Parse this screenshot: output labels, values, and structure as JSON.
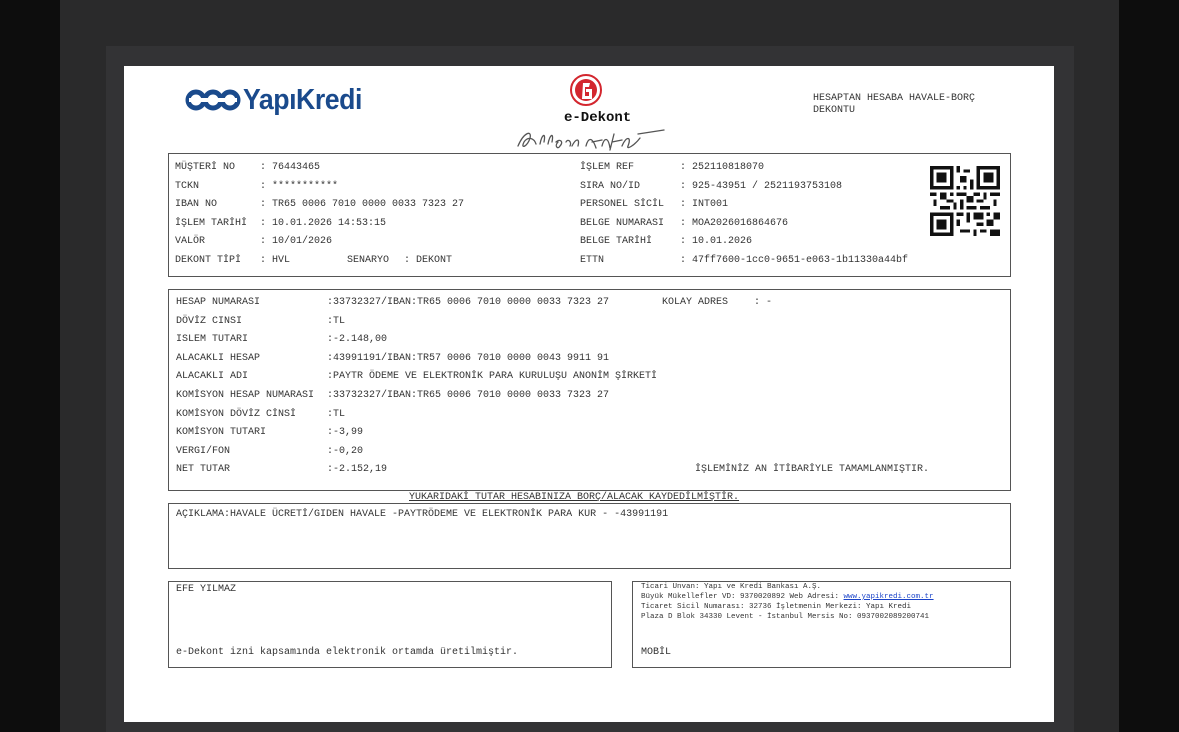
{
  "header": {
    "bank_name": "YapıKredi",
    "edekont": "e-Dekont",
    "document_title": "HESAPTAN HESABA HAVALE-BORÇ\nDEKONTU"
  },
  "customer": {
    "musteri_no": {
      "label": "MÜŞTERİ NO",
      "value": ": 76443465"
    },
    "tckn": {
      "label": "TCKN",
      "value": ": ***********"
    },
    "iban": {
      "label": "IBAN NO",
      "value": ": TR65 0006 7010 0000 0033 7323 27"
    },
    "islem_tarihi": {
      "label": "İŞLEM TARİHİ",
      "value": ": 10.01.2026 14:53:15"
    },
    "valor": {
      "label": "VALÖR",
      "value": ": 10/01/2026"
    },
    "dekont_tipi": {
      "label": "DEKONT TİPİ",
      "value": ": HVL"
    },
    "senaryo": {
      "label": "SENARYO",
      "value": ": DEKONT"
    },
    "islem_ref": {
      "label": "İŞLEM REF",
      "value": ": 252110818070"
    },
    "sira_no": {
      "label": "SIRA NO/ID",
      "value": ": 925-43951 / 2521193753108"
    },
    "personel_sicil": {
      "label": "PERSONEL SİCİL",
      "value": ": INT001"
    },
    "belge_numarasi": {
      "label": "BELGE NUMARASI",
      "value": ": MOA2026016864676"
    },
    "belge_tarihi": {
      "label": "BELGE TARİHİ",
      "value": ": 10.01.2026"
    },
    "ettn": {
      "label": "ETTN",
      "value": ": 47ff7600-1cc0-9651-e063-1b11330a44bf"
    }
  },
  "transaction": {
    "rows": [
      {
        "label": "HESAP NUMARASI",
        "value": ":33732327/IBAN:TR65 0006 7010 0000 0033 7323 27"
      },
      {
        "label": "DÖVİZ CINSI",
        "value": ":TL"
      },
      {
        "label": "ISLEM TUTARI",
        "value": ":-2.148,00"
      },
      {
        "label": "ALACAKLI HESAP",
        "value": ":43991191/IBAN:TR57 0006 7010 0000 0043 9911 91"
      },
      {
        "label": "ALACAKLI ADI",
        "value": ":PAYTR ÖDEME VE ELEKTRONİK PARA KURULUŞU ANONİM ŞİRKETİ"
      },
      {
        "label": "KOMİSYON HESAP NUMARASI",
        "value": ":33732327/IBAN:TR65 0006 7010 0000 0033 7323 27"
      },
      {
        "label": "KOMİSYON DÖVİZ CİNSİ",
        "value": ":TL"
      },
      {
        "label": "KOMİSYON TUTARI",
        "value": ":-3,99"
      },
      {
        "label": "VERGI/FON",
        "value": ":-0,20"
      },
      {
        "label": "NET TUTAR",
        "value": ":-2.152,19"
      }
    ],
    "kolay_adres_label": "KOLAY ADRES",
    "kolay_adres_value": ": -",
    "completion_note": "İŞLEMİNİZ AN İTİBARİYLE TAMAMLANMIŞTIR."
  },
  "notice": "YUKARIDAKİ TUTAR HESABINIZA BORÇ/ALACAK KAYDEDİLMİŞTİR.",
  "description": "AÇIKLAMA:HAVALE ÜCRETİ/GIDEN HAVALE -PAYTRÖDEME VE ELEKTRONİK PARA KUR - -43991191",
  "footer": {
    "customer_name": "EFE YILMAZ",
    "electronic_note": "e-Dekont izni kapsamında elektronik ortamda üretilmiştir.",
    "bank_info_1": "Ticari Unvan: Yapı ve Kredi Bankası A.Ş.",
    "bank_info_2_prefix": "Büyük Mükellefler VD: 9370020892 Web Adresi: ",
    "website": "www.yapikredi.com.tr",
    "bank_info_3": "Ticaret Sicil Numarası: 32736 İşletmenin Merkezi: Yapı Kredi",
    "bank_info_4": "Plaza D Blok 34330 Levent - İstanbul Mersis No: 0937002089200741",
    "channel": "MOBİL"
  },
  "colors": {
    "brand_blue": "#1a4a8c",
    "seal_red": "#d3262e",
    "link_blue": "#1a43c8"
  }
}
